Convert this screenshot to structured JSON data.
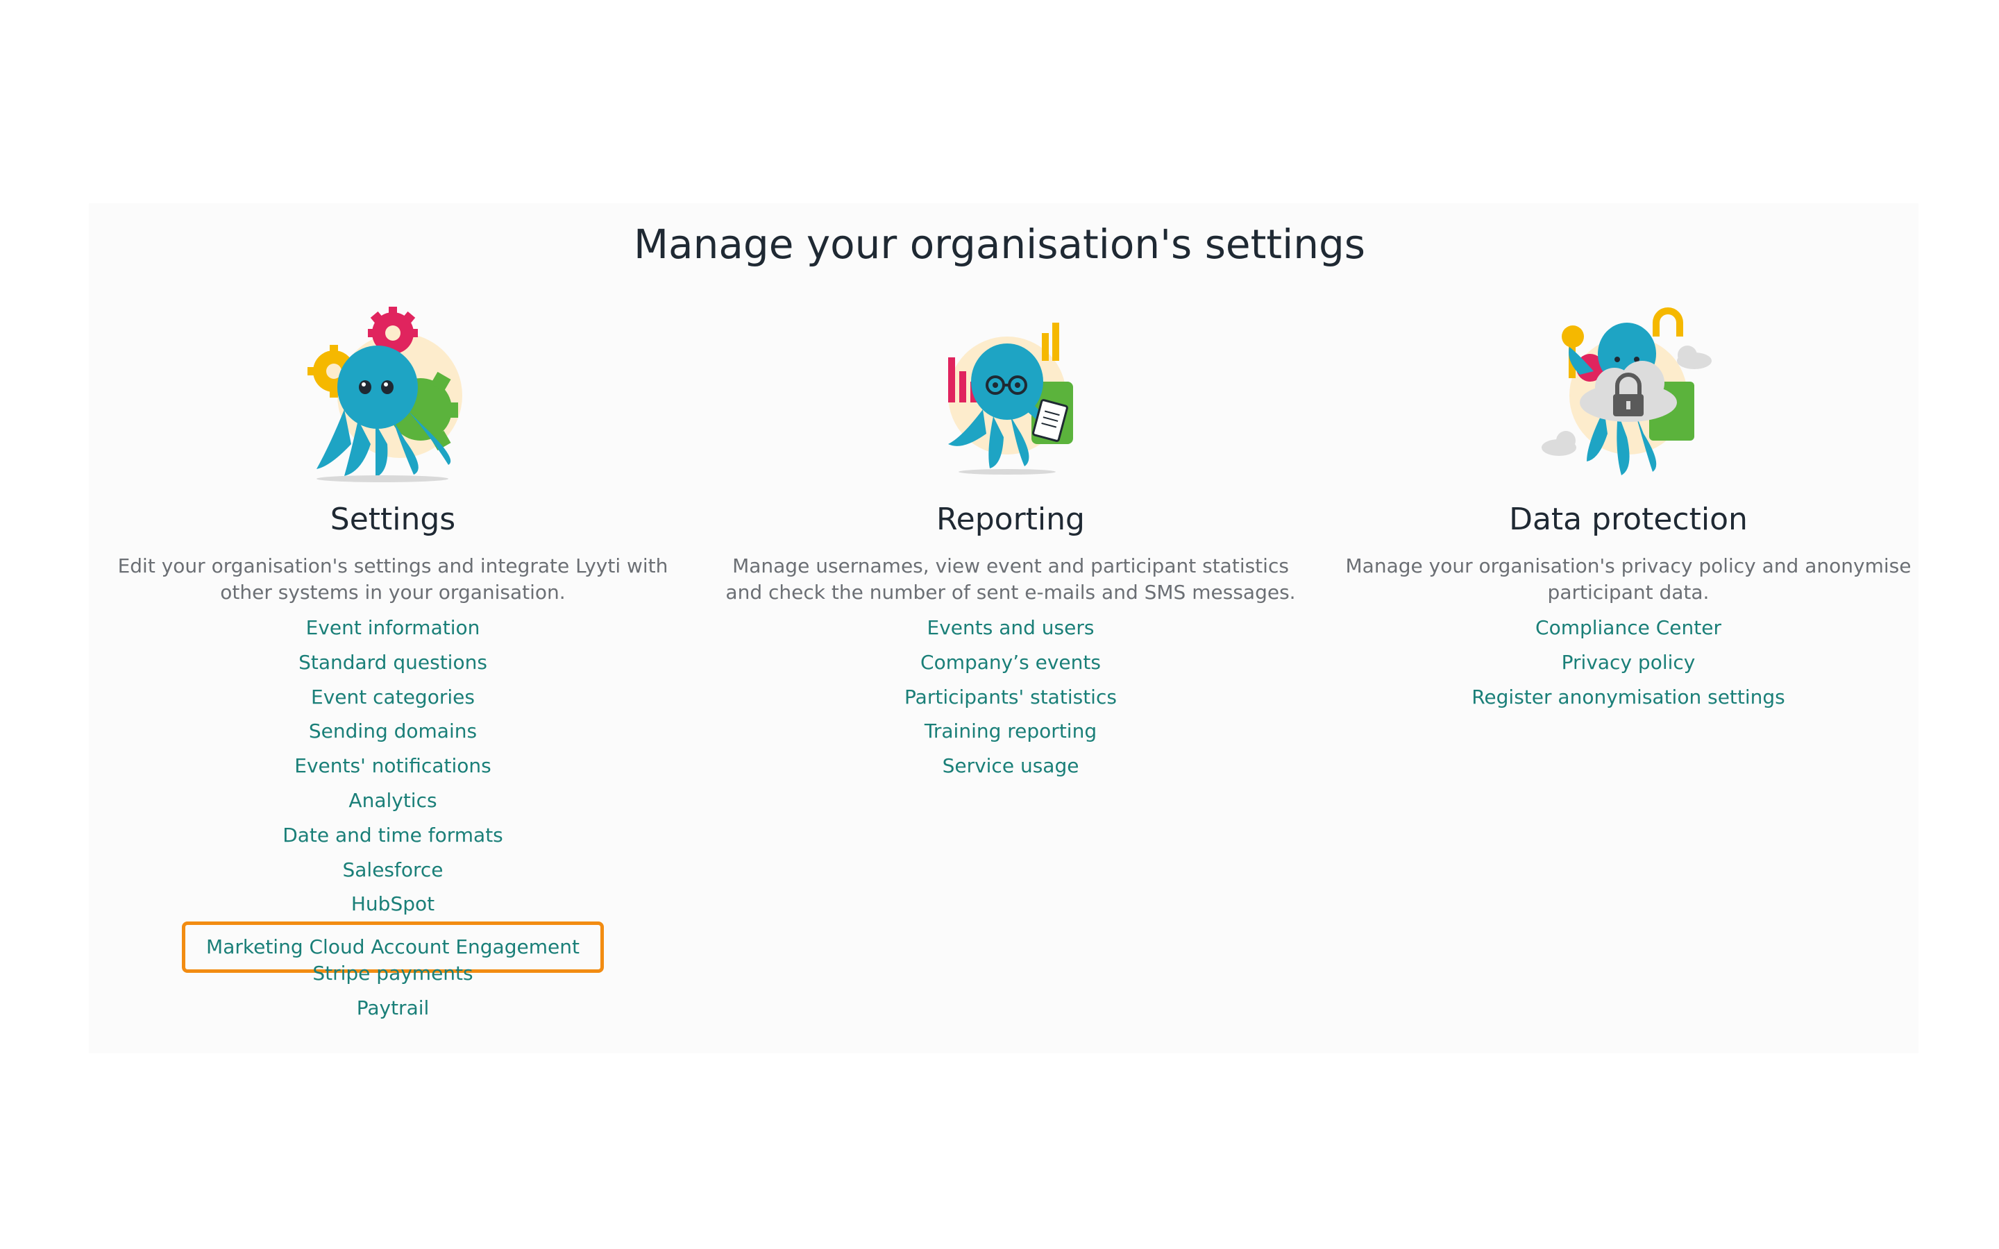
{
  "page": {
    "title": "Manage your organisation's settings"
  },
  "colors": {
    "link": "#1a7f78",
    "highlight": "#f28c12",
    "heading": "#1f2933",
    "description": "#6b6f74"
  },
  "sections": [
    {
      "title": "Settings",
      "illustration": "octopus-gears-illustration",
      "description": "Edit your organisation's settings and integrate Lyyti with other systems in your organisation.",
      "links": [
        "Event information",
        "Standard questions",
        "Event categories",
        "Sending domains",
        "Events' notifications",
        "Analytics",
        "Date and time formats",
        "Salesforce",
        "HubSpot",
        "Marketing Cloud Account Engagement",
        "Stripe payments",
        "Paytrail"
      ],
      "highlighted_link": "Marketing Cloud Account Engagement"
    },
    {
      "title": "Reporting",
      "illustration": "octopus-charts-illustration",
      "description": "Manage usernames, view event and participant statistics and check the number of sent e-mails and SMS messages.",
      "links": [
        "Events and users",
        "Company’s events",
        "Participants' statistics",
        "Training reporting",
        "Service usage"
      ]
    },
    {
      "title": "Data protection",
      "illustration": "octopus-lock-cloud-illustration",
      "description": "Manage your organisation's privacy policy and anonymise participant data.",
      "links": [
        "Compliance Center",
        "Privacy policy",
        "Register anonymisation settings"
      ]
    }
  ]
}
